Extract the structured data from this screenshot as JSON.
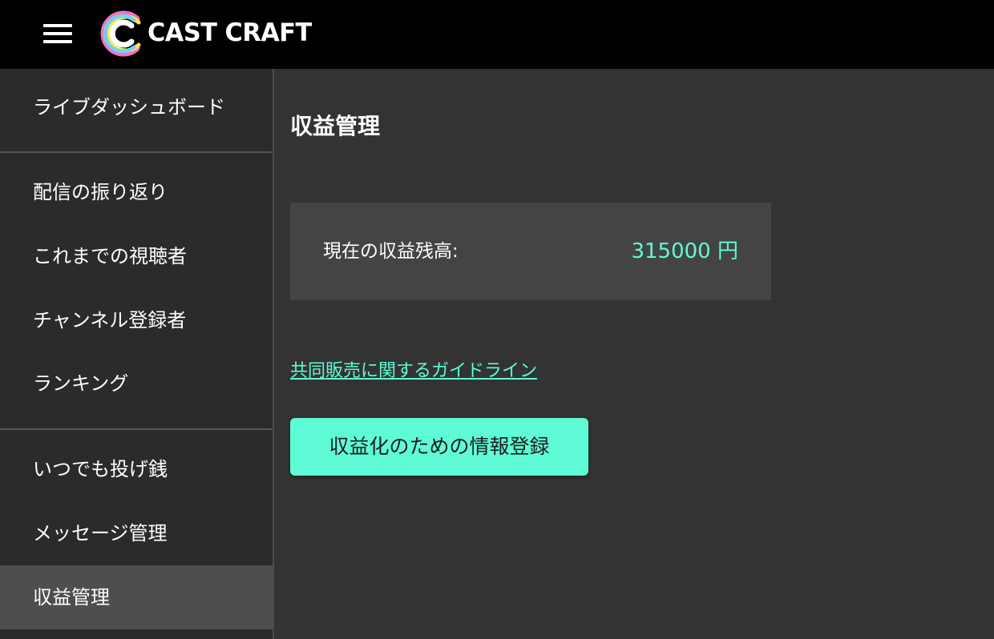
{
  "header": {
    "menu_icon": "hamburger-menu-icon",
    "logo_icon": "cast-craft-logo-icon",
    "logo_text": "CAST CRAFT"
  },
  "sidebar": {
    "items": [
      {
        "label": "ライブダッシュボード",
        "active": false
      },
      {
        "label": "配信の振り返り",
        "active": false
      },
      {
        "label": "これまでの視聴者",
        "active": false
      },
      {
        "label": "チャンネル登録者",
        "active": false
      },
      {
        "label": "ランキング",
        "active": false
      },
      {
        "label": "いつでも投げ銭",
        "active": false
      },
      {
        "label": "メッセージ管理",
        "active": false
      },
      {
        "label": "収益管理",
        "active": true
      }
    ]
  },
  "main": {
    "title": "収益管理",
    "balance_label": "現在の収益残高:",
    "balance_value": "315000 円",
    "guideline_link": "共同販売に関するガイドライン",
    "register_button": "収益化のための情報登録"
  },
  "colors": {
    "accent": "#5ffbd6",
    "topbar": "#000000",
    "sidebar": "#2b2b2b",
    "sidebar_active": "#4e4e4e",
    "main_bg": "#333333",
    "card_bg": "#444444"
  }
}
